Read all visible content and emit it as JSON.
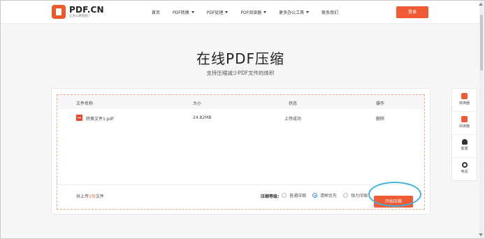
{
  "header": {
    "logo_title": "PDF.CN",
    "logo_sub": "让办公更轻松！",
    "nav": [
      {
        "label": "首页",
        "dropdown": false
      },
      {
        "label": "PDF转换",
        "dropdown": true
      },
      {
        "label": "PDF处理",
        "dropdown": true
      },
      {
        "label": "PDF阅读器",
        "dropdown": true
      },
      {
        "label": "更多办公工具",
        "dropdown": true
      },
      {
        "label": "联系我们",
        "dropdown": false
      }
    ],
    "login_label": "登录"
  },
  "page": {
    "title": "在线PDF压缩",
    "subtitle": "支持压缩减少PDF文件的体积"
  },
  "table": {
    "headers": [
      "文件名称",
      "大小",
      "状态",
      "操作"
    ],
    "rows": [
      {
        "name": "转换文件1.pdf",
        "size": "24.82MB",
        "status": "上传成功",
        "action": "删除"
      }
    ]
  },
  "footer": {
    "count_prefix": "共上传",
    "count_num": "1份",
    "count_suffix": "文件",
    "level_label": "压缩等级:",
    "options": [
      {
        "label": "普通压缩",
        "checked": false
      },
      {
        "label": "清晰优先",
        "checked": true
      },
      {
        "label": "强力压缩",
        "checked": false
      }
    ],
    "start_label": "开始压缩"
  },
  "side": [
    {
      "label": "转换器",
      "icon": "converter-icon"
    },
    {
      "label": "阅读器",
      "icon": "reader-icon"
    },
    {
      "label": "客服",
      "icon": "support-icon"
    },
    {
      "label": "电话",
      "icon": "phone-icon"
    }
  ],
  "colors": {
    "accent": "#ef5b35",
    "highlight": "#3fb2e4",
    "radio": "#3f8ef0"
  }
}
